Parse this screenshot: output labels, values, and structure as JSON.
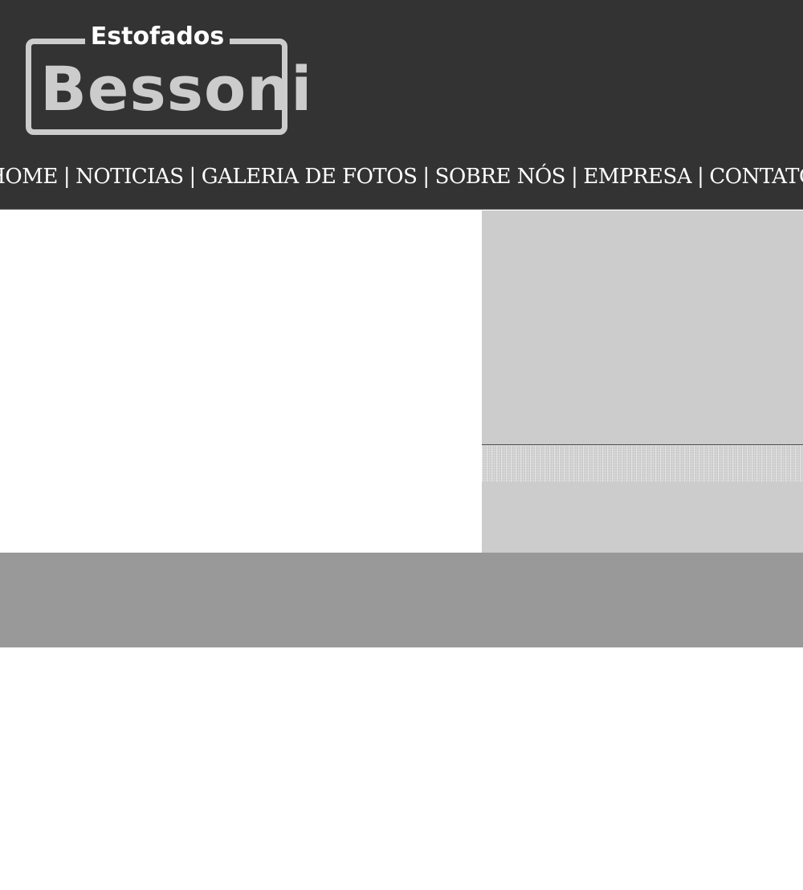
{
  "brand": {
    "top_text": "Estofados",
    "main_text": "Bessoni"
  },
  "nav": {
    "items": [
      {
        "label": "HOME"
      },
      {
        "label": "NOTICIAS"
      },
      {
        "label": "GALERIA DE FOTOS"
      },
      {
        "label": "SOBRE NÓS"
      },
      {
        "label": "EMPRESA"
      },
      {
        "label": "CONTATO"
      }
    ],
    "separator": "|"
  },
  "colors": {
    "header_bg": "#333333",
    "logo_gray": "#cccccc",
    "sidebar_bg": "#cccccc",
    "footer_bg": "#999999",
    "content_bg": "#ffffff"
  }
}
